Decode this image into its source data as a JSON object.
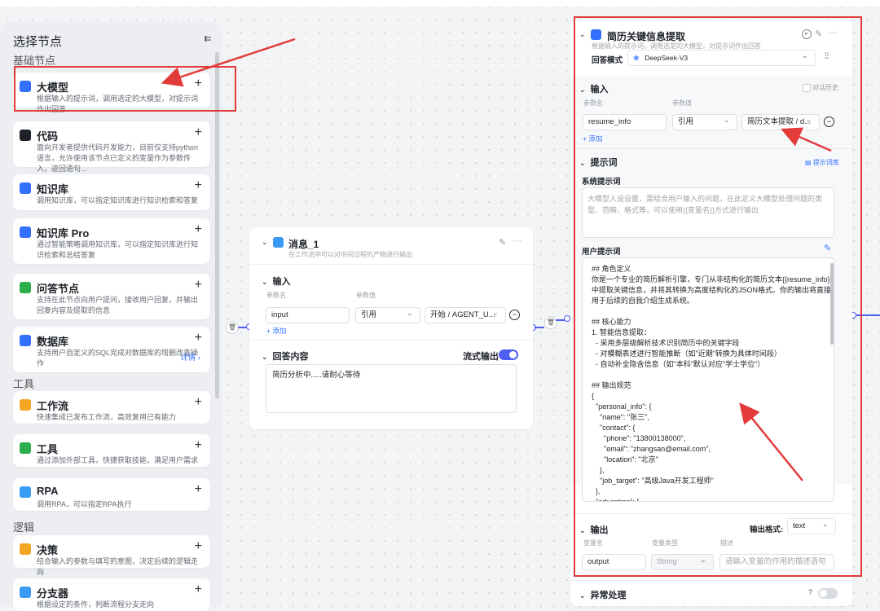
{
  "left_panel": {
    "title": "选择节点",
    "sections": {
      "basic": "基础节点",
      "tools": "工具",
      "logic": "逻辑"
    },
    "cards": [
      {
        "name": "llm",
        "title": "大模型",
        "desc": "根据输入的提示词，调用选定的大模型，对提示词作出回答",
        "icon_color": "#3370ff"
      },
      {
        "name": "code",
        "title": "代码",
        "desc": "面向开发者提供代码开发能力，目前仅支持python语言，允许使用该节点已定义的变量作为参数传入，返回语句...",
        "icon_color": "#1f2329"
      },
      {
        "name": "knowledge",
        "title": "知识库",
        "desc": "调用知识库，可以指定知识库进行知识检索和答复",
        "icon_color": "#3370ff"
      },
      {
        "name": "knowledge-pro",
        "title": "知识库 Pro",
        "desc": "通过智能策略调用知识库，可以指定知识库进行知识检索和总结答复",
        "icon_color": "#3370ff"
      },
      {
        "name": "qa",
        "title": "问答节点",
        "desc": "支持在此节点向用户提问，接收用户回复，并输出回复内容及提取的信息",
        "icon_color": "#2bae4b"
      },
      {
        "name": "database",
        "title": "数据库",
        "desc": "支持用户自定义的SQL完成对数据库的增删改查操作",
        "icon_color": "#3370ff",
        "detail": "详情"
      },
      {
        "name": "workflow",
        "title": "工作流",
        "desc": "快速集成已发布工作流，高效复用已有能力",
        "icon_color": "#f5a623"
      },
      {
        "name": "tool",
        "title": "工具",
        "desc": "通过添加外部工具，快捷获取技能，满足用户需求",
        "icon_color": "#2bae4b"
      },
      {
        "name": "rpa",
        "title": "RPA",
        "desc": "调用RPA，可以指定RPA执行",
        "icon_color": "#3a9bf5"
      },
      {
        "name": "decision",
        "title": "决策",
        "desc": "结合输入的参数与填写的意图，决定后续的逻辑走向",
        "icon_color": "#f5a623"
      },
      {
        "name": "branch",
        "title": "分支器",
        "desc": "根据设定的条件，判断流程分支走向",
        "icon_color": "#3a9bf5"
      }
    ],
    "plus": "+"
  },
  "message_node": {
    "title": "消息_1",
    "subtitle": "在工作流中可以对中间过程的产物进行输出",
    "input_section": "输入",
    "param_name_label": "参数名",
    "param_value_label": "参数值",
    "param_name": "input",
    "ref_type": "引用",
    "ref_value": "开始 / AGENT_U...",
    "add": "+ 添加",
    "answer_section": "回答内容",
    "stream_label": "流式输出",
    "answer_text": "简历分析中.....请耐心等待"
  },
  "llm_node": {
    "title": "简历关键信息提取",
    "subtitle": "根据输入的提示词，调用选定的大模型，对提示词作出回答",
    "mode_label": "回答模式",
    "model": "DeepSeek-V3",
    "input_section": "输入",
    "history_label": "对话历史",
    "param_name_label": "参数名",
    "param_value_label": "参数值",
    "param_name": "resume_info",
    "ref_type": "引用",
    "ref_value": "简历文本提取 / d...",
    "add": "+ 添加",
    "prompt_section": "提示词",
    "prompt_lib": "提示词库",
    "system_prompt_label": "系统提示词",
    "system_prompt_placeholder": "大模型人设设置，需结合用户输入的问题，在此定义大模型处理问题的类型、范畴、格式等，可以使用{{变量名}}方式进行输出",
    "user_prompt_label": "用户提示词",
    "user_prompt": "## 角色定义\n你是一个专业的简历解析引擎，专门从非结构化的简历文本{{resume_info}}中提取关键信息，并将其转换为高度结构化的JSON格式。你的输出将直接用于后续的自我介绍生成系统。\n\n## 核心能力\n1. 智能信息提取：\n  - 采用多层级解析技术识别简历中的关键字段\n  - 对模糊表述进行智能推断（如\"近期\"转换为具体时间段）\n  - 自动补全隐含信息（如\"本科\"默认对应\"学士学位\"）\n\n## 输出规范\n{\n  \"personal_info\": {\n    \"name\": \"张三\",\n    \"contact\": {\n      \"phone\": \"13800138000\",\n      \"email\": \"zhangsan@email.com\",\n      \"location\": \"北京\"\n    },\n    \"job_target\": \"高级Java开发工程师\"\n  },\n  \"education\": [\n    {\n      \"institution\": \"清华大学\",",
    "output_section": "输出",
    "output_format_label": "输出格式:",
    "output_format": "text",
    "var_name_label": "变量名",
    "var_type_label": "变量类型",
    "desc_label": "描述",
    "var_name": "output",
    "var_type": "String",
    "desc_placeholder": "请输入变量的作用的描述语句",
    "exception_section": "异常处理"
  },
  "colors": {
    "accent": "#3370ff",
    "connector": "#4e5df2",
    "highlight": "#e33a3a"
  }
}
